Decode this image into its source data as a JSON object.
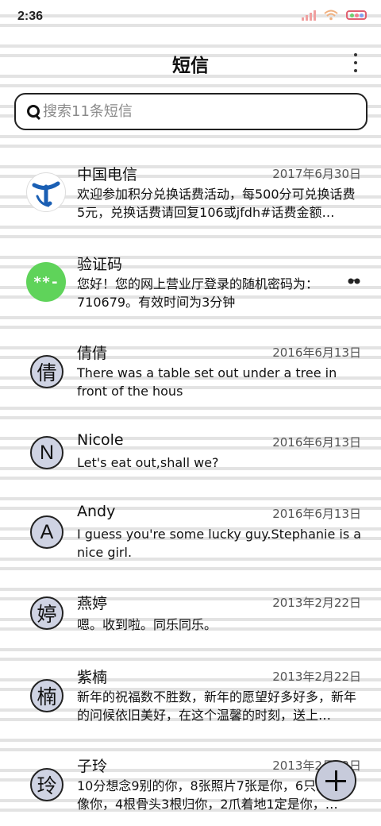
{
  "status_bar": {
    "time": "2:36"
  },
  "header": {
    "title": "短信"
  },
  "search": {
    "placeholder": "搜索11条短信"
  },
  "conversations": [
    {
      "name": "中国电信",
      "date": "2017年6月30日",
      "avatar_type": "telecom-logo-icon",
      "preview": "欢迎参加积分兑换话费活动，每500分可兑换话费5元，兑换话费请回复106或jfdh#话费金额…"
    },
    {
      "name": "验证码",
      "date": "",
      "avatar_type": "green-badge",
      "avatar_text": "**-",
      "preview": "您好！您的网上营业厅登录的随机密码为：710679。有效时间为3分钟"
    },
    {
      "name": "倩倩",
      "date": "2016年6月13日",
      "avatar_type": "letter",
      "avatar_text": "倩",
      "preview": "There was a table set out under a tree in front of the hous"
    },
    {
      "name": "Nicole",
      "date": "2016年6月13日",
      "avatar_type": "letter",
      "avatar_text": "N",
      "preview": "Let's eat out,shall we?"
    },
    {
      "name": "Andy",
      "date": "2016年6月13日",
      "avatar_type": "letter",
      "avatar_text": "A",
      "preview": "I guess you're some lucky guy.Stephanie is a nice girl."
    },
    {
      "name": "燕婷",
      "date": "2013年2月22日",
      "avatar_type": "letter",
      "avatar_text": "婷",
      "preview": "嗯。收到啦。同乐同乐。"
    },
    {
      "name": "紫楠",
      "date": "2013年2月22日",
      "avatar_type": "letter",
      "avatar_text": "楠",
      "preview": "新年的祝福数不胜数，新年的愿望好多好多，新年的问候依旧美好，在这个温馨的时刻，送上…"
    },
    {
      "name": "子玲",
      "date": "2013年2月22日",
      "avatar_type": "letter",
      "avatar_text": "玲",
      "preview": "10分想念9别的你，8张照片7张是你，6只眼睛只像你，4根骨头3根归你，2爪着地1定是你，…"
    }
  ],
  "colors": {
    "avatar_fill": "#cfd3e3",
    "green_badge": "#5fd35a",
    "telecom_blue": "#1a5fb4"
  }
}
